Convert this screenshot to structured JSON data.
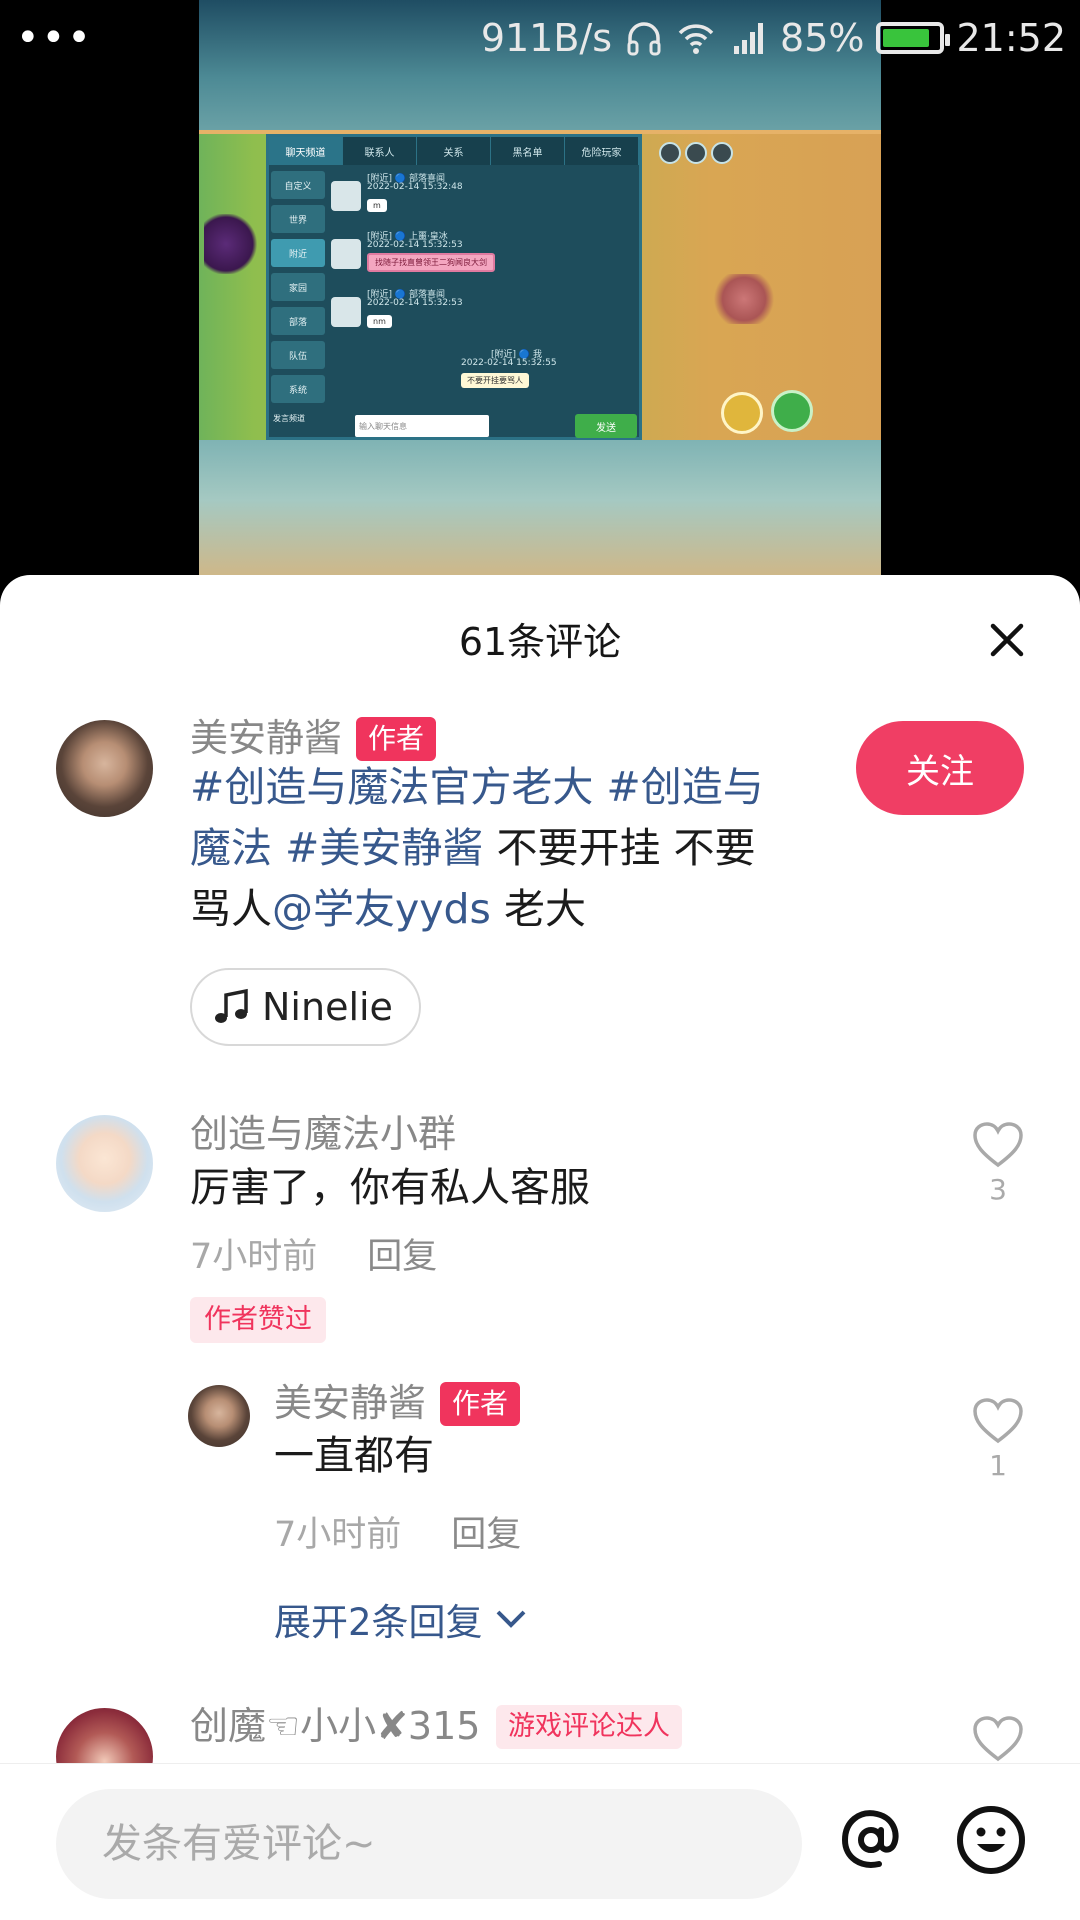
{
  "status_bar": {
    "speed": "911B/s",
    "battery_percent": "85%",
    "battery_level": 0.85,
    "time": "21:52"
  },
  "game": {
    "tabs": [
      "聊天频道",
      "联系人",
      "关系",
      "黑名单",
      "危险玩家"
    ],
    "channels": [
      "自定义",
      "世界",
      "附近",
      "家园",
      "部落",
      "队伍",
      "系统"
    ],
    "messages": [
      {
        "header": "[附近] 🔵 部落喜闻",
        "time": "2022-02-14 15:32:48",
        "text": "m"
      },
      {
        "header": "[附近] 🔵 上噩·皇冰",
        "time": "2022-02-14 15:32:53",
        "text": "找随子找直曾领王二狗闻良大剑"
      },
      {
        "header": "[附近] 🔵 部落喜闻",
        "time": "2022-02-14 15:32:53",
        "text": "nm"
      },
      {
        "header": "[附近] 🔵 我",
        "time": "2022-02-14 15:32:55",
        "text": "不要开挂要骂人"
      }
    ],
    "input_placeholder": "输入聊天信息",
    "send_label": "发送",
    "footer_label": "发言频道"
  },
  "sheet": {
    "title": "61条评论"
  },
  "post": {
    "author": "美安静酱",
    "author_badge": "作者",
    "follow_label": "关注",
    "hashtag1": "#创造与魔法官方老大",
    "hashtag2a": "#创造与",
    "hashtag2b": "魔法",
    "hashtag3": "#美安静酱",
    "text1": " 不要开挂 不要",
    "text2a": "骂人",
    "mention": "@学友yyds",
    "text2b": " 老大",
    "music": "Ninelie"
  },
  "comments": [
    {
      "user": "创造与魔法小群",
      "text": "厉害了，你有私人客服",
      "time": "7小时前",
      "reply_label": "回复",
      "likes": "3",
      "author_liked": "作者赞过"
    },
    {
      "user": "美安静酱",
      "badge": "作者",
      "text": "一直都有",
      "time": "7小时前",
      "reply_label": "回复",
      "likes": "1"
    },
    {
      "user": "创魔☜小小✘315",
      "badge": "游戏评论达人"
    }
  ],
  "expand_label": "展开2条回复",
  "input": {
    "placeholder": "发条有爱评论~"
  },
  "icons": {
    "close": "close-icon",
    "music": "music-note-icon",
    "heart": "heart-outline-icon",
    "at": "at-sign-icon",
    "emoji": "smiley-icon",
    "chevron": "chevron-down-icon"
  },
  "colors": {
    "accent": "#f03e64",
    "link": "#37588c",
    "badge_bg": "#fde8ec"
  }
}
